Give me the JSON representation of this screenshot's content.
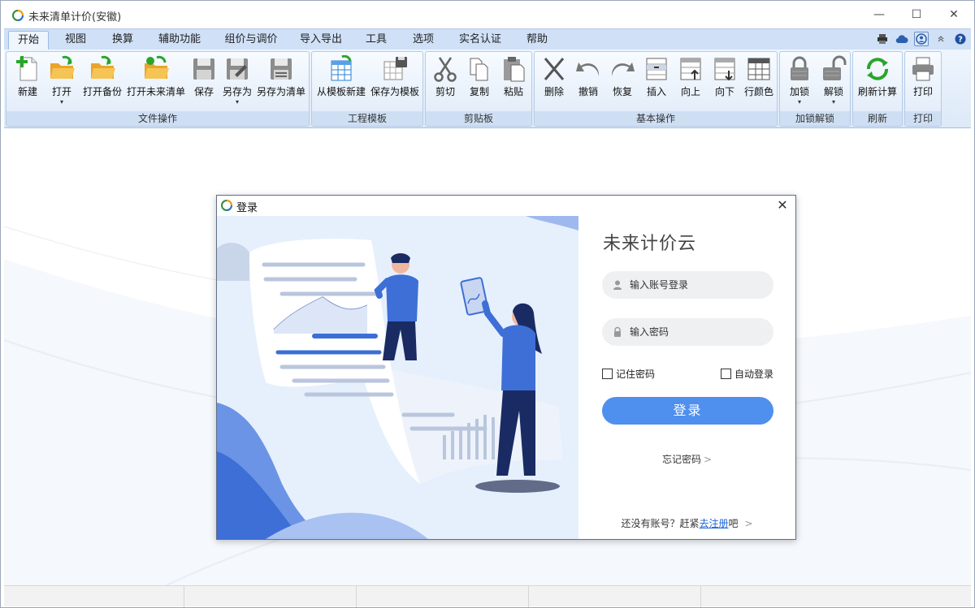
{
  "window": {
    "title": "未来清单计价(安徽)",
    "controls": {
      "minimize": "—",
      "maximize": "☐",
      "close": "✕"
    }
  },
  "menu": {
    "tabs": [
      {
        "label": "开始",
        "active": true
      },
      {
        "label": "视图"
      },
      {
        "label": "换算"
      },
      {
        "label": "辅助功能"
      },
      {
        "label": "组价与调价"
      },
      {
        "label": "导入导出"
      },
      {
        "label": "工具"
      },
      {
        "label": "选项"
      },
      {
        "label": "实名认证"
      },
      {
        "label": "帮助"
      }
    ],
    "right_icons": [
      "printer-icon",
      "cloud-icon",
      "user-icon",
      "collapse-ribbon-icon",
      "help-icon"
    ],
    "help_glyph": "?"
  },
  "ribbon": {
    "groups": [
      {
        "label": "文件操作",
        "buttons": [
          "新建",
          "打开",
          "打开备份",
          "打开未来清单",
          "保存",
          "另存为",
          "另存为清单"
        ]
      },
      {
        "label": "工程模板",
        "buttons": [
          "从模板新建",
          "保存为模板"
        ]
      },
      {
        "label": "剪贴板",
        "buttons": [
          "剪切",
          "复制",
          "粘贴"
        ]
      },
      {
        "label": "基本操作",
        "buttons": [
          "删除",
          "撤销",
          "恢复",
          "插入",
          "向上",
          "向下",
          "行颜色"
        ]
      },
      {
        "label": "加锁解锁",
        "buttons": [
          "加锁",
          "解锁"
        ]
      },
      {
        "label": "刷新",
        "buttons": [
          "刷新计算"
        ]
      },
      {
        "label": "打印",
        "buttons": [
          "打印"
        ]
      }
    ]
  },
  "dialog": {
    "title": "登录",
    "close_glyph": "✕",
    "brand": "未来计价云",
    "account_placeholder": "输入账号登录",
    "password_placeholder": "输入密码",
    "remember_label": "记住密码",
    "auto_login_label": "自动登录",
    "login_button": "登录",
    "forgot_label": "忘记密码",
    "arrow": ">",
    "register_prefix": "还没有账号？赶紧",
    "register_link": "去注册",
    "register_suffix": "吧"
  },
  "colors": {
    "accent": "#4f8fee",
    "ribbon_bg": "#dde9f8",
    "menubar_bg": "#cfe0f7",
    "illustration_bg": "#e6f0fd",
    "illustration_blue": "#3b6fd6"
  }
}
